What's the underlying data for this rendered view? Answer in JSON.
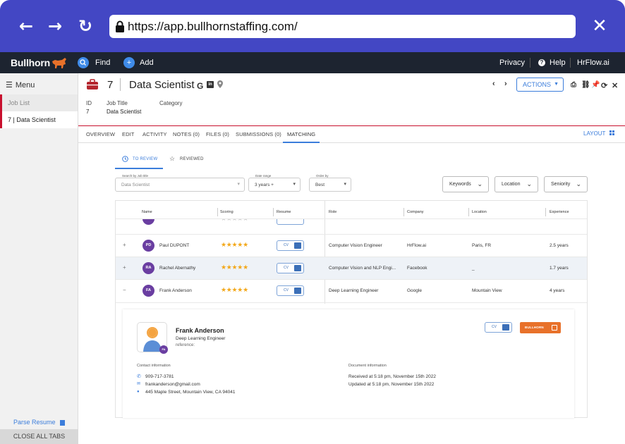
{
  "browser": {
    "url": "https://app.bullhornstaffing.com/",
    "back_icon": "←",
    "forward_icon": "→",
    "reload_icon": "↻",
    "close_icon": "✕"
  },
  "topbar": {
    "logo": "Bullhorn",
    "find": "Find",
    "add": "Add",
    "privacy": "Privacy",
    "help": "Help",
    "account": "HrFlow.ai"
  },
  "sidebar": {
    "menu": "Menu",
    "items": [
      "Job List",
      "7 | Data Scientist"
    ],
    "parse_resume": "Parse Resume",
    "close_all": "CLOSE ALL TABS"
  },
  "job": {
    "id": "7",
    "title": "Data Scientist",
    "g_icon": "G",
    "actions": "ACTIONS",
    "meta": {
      "id_label": "ID",
      "id_value": "7",
      "title_label": "Job Title",
      "title_value": "Data Scientist",
      "category_label": "Category"
    }
  },
  "tabs": [
    "OVERVIEW",
    "EDIT",
    "ACTIVITY",
    "NOTES (0)",
    "FILES (0)",
    "SUBMISSIONS (0)",
    "MATCHING"
  ],
  "layout_label": "LAYOUT",
  "subtabs": {
    "to_review": "TO REVIEW",
    "reviewed": "REVIEWED"
  },
  "filters": {
    "job_title": {
      "label": "Search by Job title",
      "value": "Data Scientist"
    },
    "date_range": {
      "label": "Date range",
      "value": "3 years +"
    },
    "order_by": {
      "label": "Order by",
      "value": "Best"
    },
    "buttons": [
      "Keywords",
      "Location",
      "Seniority"
    ]
  },
  "table": {
    "headers": [
      "Name",
      "Scoring",
      "Resume",
      "Role",
      "Company",
      "Location",
      "Experience"
    ],
    "rows": [
      {
        "toggle": "+",
        "initials": "PD",
        "name": "Paul DUPONT",
        "stars": "★★★★★",
        "cv": "CV",
        "role": "Computer Vision Engineer",
        "company": "HrFlow.ai",
        "location": "Paris, FR",
        "experience": "2.5 years"
      },
      {
        "toggle": "+",
        "initials": "RA",
        "name": "Rachel Abernathy",
        "stars": "★★★★★",
        "cv": "CV",
        "role": "Computer Vision and NLP Engi...",
        "company": "Facebook",
        "location": "_",
        "experience": "1.7 years"
      },
      {
        "toggle": "−",
        "initials": "FA",
        "name": "Frank Anderson",
        "stars": "★★★★★",
        "cv": "CV",
        "role": "Deep Learning Engineer",
        "company": "Google",
        "location": "Mountain View",
        "experience": "4 years"
      }
    ]
  },
  "detail": {
    "initials": "FA",
    "name": "Frank Anderson",
    "role": "Deep Learning Engineer",
    "reference": "reference:",
    "cv": "CV",
    "bullhorn_btn": "BULLHORN",
    "contact_label": "Contact information",
    "phone": "909-717-3781",
    "email": "frankanderson@gmail.com",
    "address": "445 Maple Street, Mountain View, CA 94041",
    "document_label": "Document information",
    "received": "Received at 5:18 pm, November 15th 2022",
    "updated": "Updated at 5:18 pm, November 15th 2022"
  }
}
